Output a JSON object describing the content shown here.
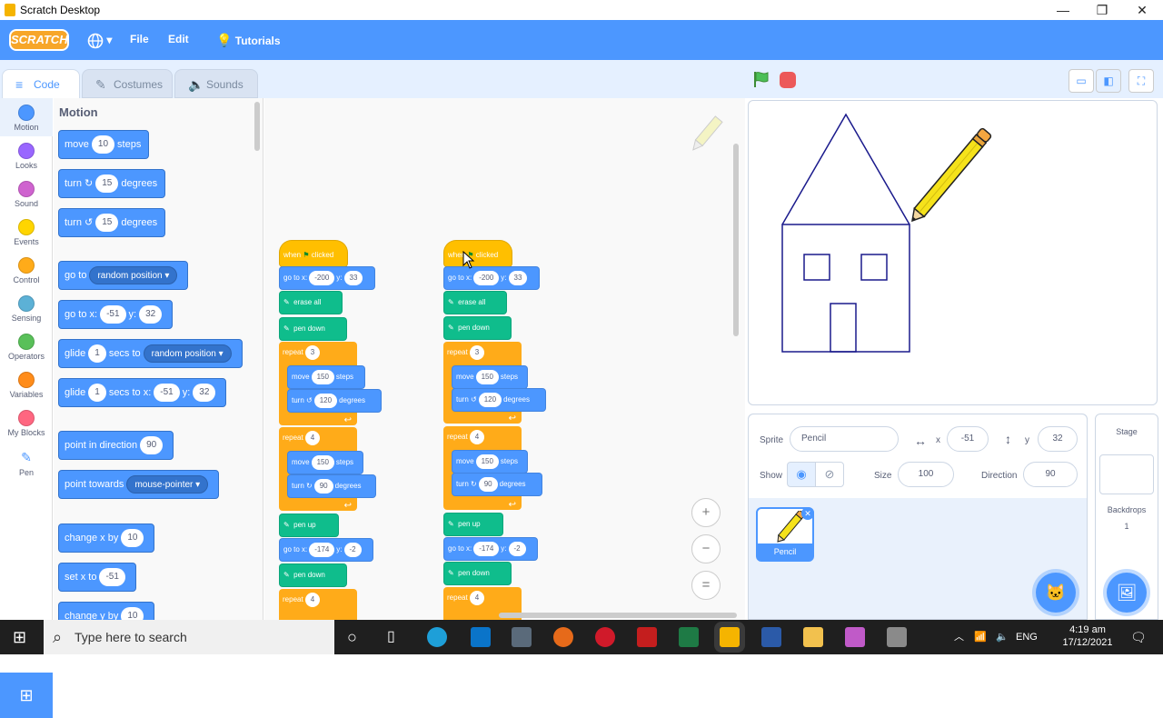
{
  "window": {
    "title": "Scratch Desktop",
    "min": "—",
    "max": "❐",
    "close": "✕"
  },
  "menu": {
    "logo": "SCRATCH",
    "language_icon": "globe-icon",
    "language_arrow": "▾",
    "file": "File",
    "edit": "Edit",
    "tutorials": "Tutorials"
  },
  "tabs": [
    {
      "label": "Code",
      "icon": "≡"
    },
    {
      "label": "Costumes",
      "icon": "✎"
    },
    {
      "label": "Sounds",
      "icon": "🔈"
    }
  ],
  "categories": [
    {
      "label": "Motion",
      "color": "#4c97ff"
    },
    {
      "label": "Looks",
      "color": "#9966ff"
    },
    {
      "label": "Sound",
      "color": "#cf63cf"
    },
    {
      "label": "Events",
      "color": "#ffd500"
    },
    {
      "label": "Control",
      "color": "#ffab19"
    },
    {
      "label": "Sensing",
      "color": "#5cb1d6"
    },
    {
      "label": "Operators",
      "color": "#59c059"
    },
    {
      "label": "Variables",
      "color": "#ff8c1a"
    },
    {
      "label": "My Blocks",
      "color": "#ff6680"
    },
    {
      "label": "Pen",
      "color": "#0fbd8c"
    }
  ],
  "ext_icon": "⊞",
  "palette": {
    "heading": "Motion",
    "move": {
      "a": "move",
      "v": "10",
      "b": "steps"
    },
    "turn_cw": {
      "a": "turn",
      "icon": "↻",
      "v": "15",
      "b": "degrees"
    },
    "turn_ccw": {
      "a": "turn",
      "icon": "↺",
      "v": "15",
      "b": "degrees"
    },
    "goto": {
      "a": "go to",
      "v": "random position ▾"
    },
    "gotoxy": {
      "a": "go to x:",
      "x": "-51",
      "b": "y:",
      "y": "32"
    },
    "glide1": {
      "a": "glide",
      "v": "1",
      "b": "secs to",
      "c": "random position ▾"
    },
    "glide2": {
      "a": "glide",
      "v": "1",
      "b": "secs to x:",
      "x": "-51",
      "c": "y:",
      "y": "32"
    },
    "point_dir": {
      "a": "point in direction",
      "v": "90"
    },
    "point_towards": {
      "a": "point towards",
      "v": "mouse-pointer ▾"
    },
    "change_x": {
      "a": "change x by",
      "v": "10"
    },
    "set_x": {
      "a": "set x to",
      "v": "-51"
    },
    "change_y": {
      "a": "change y by",
      "v": "10"
    }
  },
  "script": {
    "hat": {
      "a": "when",
      "b": "clicked"
    },
    "goto1": {
      "a": "go to x:",
      "x": "-200",
      "b": "y:",
      "y": "33"
    },
    "erase": "erase all",
    "pendown": "pen down",
    "penup": "pen up",
    "repeat": "repeat",
    "rep1": "3",
    "rep2": "4",
    "move": "move",
    "steps": "steps",
    "steps2": "steps",
    "turn": "turn",
    "degrees": "degrees",
    "m150": "150",
    "t120": "120",
    "t90": "90",
    "goto2": {
      "a": "go to x:",
      "x": "-174",
      "b": "y:",
      "y": "-2"
    },
    "loop_arrow": "↩",
    "ccw": "↺",
    "cw": "↻"
  },
  "zoom": {
    "in": "+",
    "out": "−",
    "reset": "="
  },
  "stage_controls": {
    "small": "▭",
    "normal": "◧",
    "full": "⛶"
  },
  "sprite": {
    "label_sprite": "Sprite",
    "name": "Pencil",
    "x_label": "x",
    "x": "-51",
    "y_label": "y",
    "y": "32",
    "x_icon": "↔",
    "y_icon": "↕",
    "show": "Show",
    "show_icon": "◉",
    "hide_icon": "⊘",
    "size_label": "Size",
    "size": "100",
    "dir_label": "Direction",
    "direction": "90",
    "card_name": "Pencil",
    "card_delete": "✕"
  },
  "stage_panel": {
    "title": "Stage",
    "backdrops": "Backdrops",
    "count": "1"
  },
  "fabs": {
    "sprite": "🐱",
    "backdrop": "🖼"
  },
  "taskbar": {
    "search": "Type here to search",
    "lang": "ENG",
    "time": "4:19 am",
    "date": "17/12/2021",
    "start_icon": "⊞",
    "search_icon": "⌕",
    "caret": "︿",
    "cortana": "○",
    "taskview": "▯",
    "wifi": "📶",
    "sound": "🔈",
    "notif": "🗨"
  }
}
